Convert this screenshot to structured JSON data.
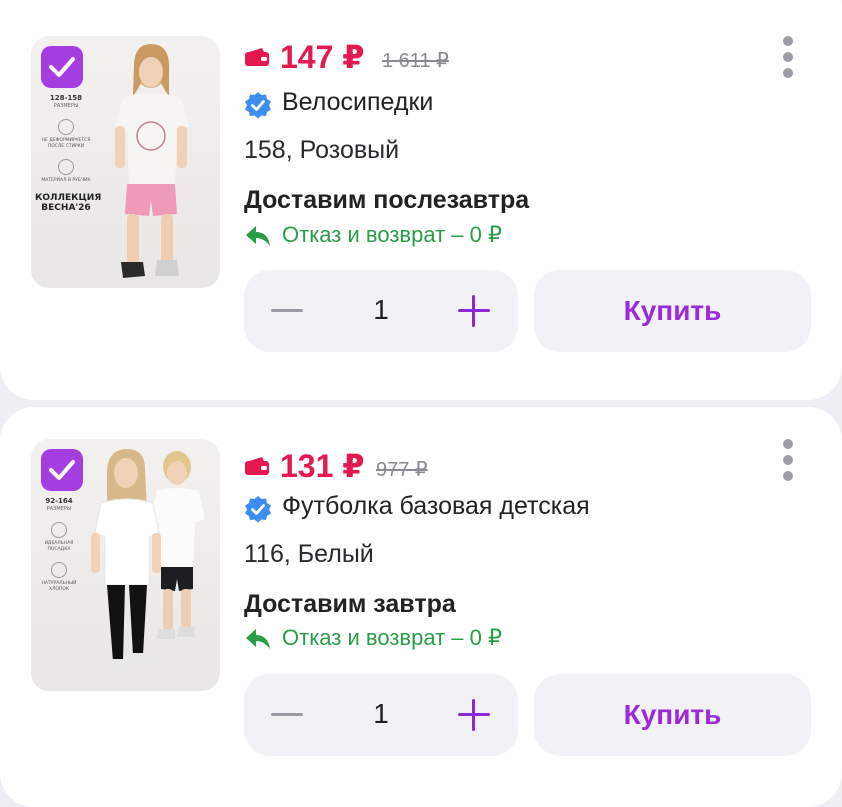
{
  "items": [
    {
      "price": "147 ₽",
      "old_price": "1 611 ₽",
      "brand": "Велосипедки",
      "variant": "158, Розовый",
      "delivery": "Доставим послезавтра",
      "return_policy": "Отказ и возврат – 0 ₽",
      "quantity": "1",
      "buy_label": "Купить",
      "image": {
        "size_range": "128-158",
        "size_sub": "РАЗМЕРЫ",
        "feature_1": "НЕ ДЕФОРМИРУЕТСЯ ПОСЛЕ СТИРКИ",
        "feature_2": "МАТЕРИАЛ В РУБЧИК",
        "collection": "КОЛЛЕКЦИЯ ВЕСНА'26"
      }
    },
    {
      "price": "131 ₽",
      "old_price": "977 ₽",
      "brand": "Футболка базовая детская",
      "variant": "116, Белый",
      "delivery": "Доставим завтра",
      "return_policy": "Отказ и возврат – 0 ₽",
      "quantity": "1",
      "buy_label": "Купить",
      "image": {
        "size_range": "92-164",
        "size_sub": "РАЗМЕРЫ",
        "feature_1": "ИДЕАЛЬНАЯ ПОСАДКА",
        "feature_2": "НАТУРАЛЬНЫЙ ХЛОПОК"
      }
    }
  ],
  "colors": {
    "price": "#e51950",
    "accent": "#9b2bd8",
    "return": "#2a9d48",
    "verified": "#3d8ef0"
  },
  "icons": [
    "checkbox-checked-icon",
    "wallet-icon",
    "verified-badge-icon",
    "return-arrow-icon",
    "minus-icon",
    "plus-icon",
    "more-vertical-icon"
  ]
}
